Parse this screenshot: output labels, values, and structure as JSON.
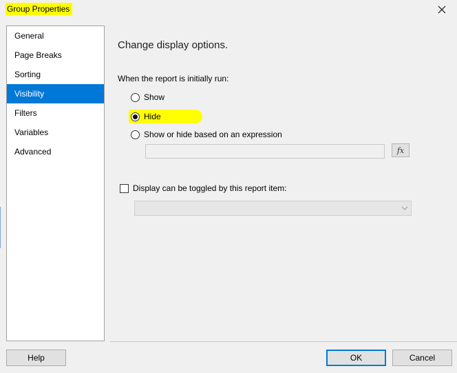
{
  "window": {
    "title": "Group Properties",
    "close_icon": "close-icon"
  },
  "sidebar": {
    "items": [
      {
        "label": "General",
        "selected": false
      },
      {
        "label": "Page Breaks",
        "selected": false
      },
      {
        "label": "Sorting",
        "selected": false
      },
      {
        "label": "Visibility",
        "selected": true
      },
      {
        "label": "Filters",
        "selected": false
      },
      {
        "label": "Variables",
        "selected": false
      },
      {
        "label": "Advanced",
        "selected": false
      }
    ]
  },
  "main": {
    "heading": "Change display options.",
    "run_label": "When the report is initially run:",
    "options": [
      {
        "label": "Show",
        "checked": false
      },
      {
        "label": "Hide",
        "checked": true
      },
      {
        "label": "Show or hide based on an expression",
        "checked": false
      }
    ],
    "expression_value": "",
    "fx_label": "fx",
    "toggle_label": "Display can be toggled by this report item:",
    "toggle_checked": false,
    "toggle_item_value": ""
  },
  "buttons": {
    "help": "Help",
    "ok": "OK",
    "cancel": "Cancel"
  },
  "colors": {
    "selection": "#0078d7",
    "highlight": "#ffff00"
  }
}
